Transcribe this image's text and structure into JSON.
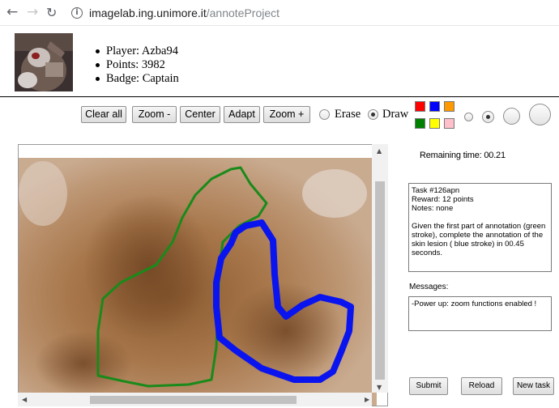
{
  "browser": {
    "back_icon": "arrow-left-icon",
    "forward_icon": "arrow-right-icon",
    "reload_icon": "reload-icon",
    "info_icon": "info-icon",
    "url_host": "imagelab.ing.unimore.it",
    "url_path": "/annoteProject"
  },
  "player": {
    "name": "Player: Azba94",
    "points": "Points: 3982",
    "badge": "Badge: Captain"
  },
  "toolbar": {
    "clear_all": "Clear all",
    "zoom_out": "Zoom -",
    "center": "Center",
    "adapt": "Adapt",
    "zoom_in": "Zoom +",
    "erase_label": "Erase",
    "draw_label": "Draw",
    "mode_selected": "Draw",
    "colors": [
      "#ff0000",
      "#0000ff",
      "#ff9900",
      "#008000",
      "#ffff00",
      "#ffc0cb"
    ],
    "brush_size_selected_index": 1
  },
  "status": {
    "remaining_time": "Remaining time: 00.21"
  },
  "task": {
    "text": "Task  #126apn\nReward: 12 points\nNotes: none\n\nGiven the first part of annotation (green stroke), complete the annotation of the skin lesion ( blue stroke)  in 00.45 seconds."
  },
  "messages": {
    "label": "Messages:",
    "text": "-Power up: zoom functions enabled !"
  },
  "actions": {
    "submit": "Submit",
    "reload": "Reload",
    "new_task": "New task"
  },
  "annotation": {
    "given_stroke_color": "#1a8a1a",
    "user_stroke_color": "#0a14ee"
  }
}
